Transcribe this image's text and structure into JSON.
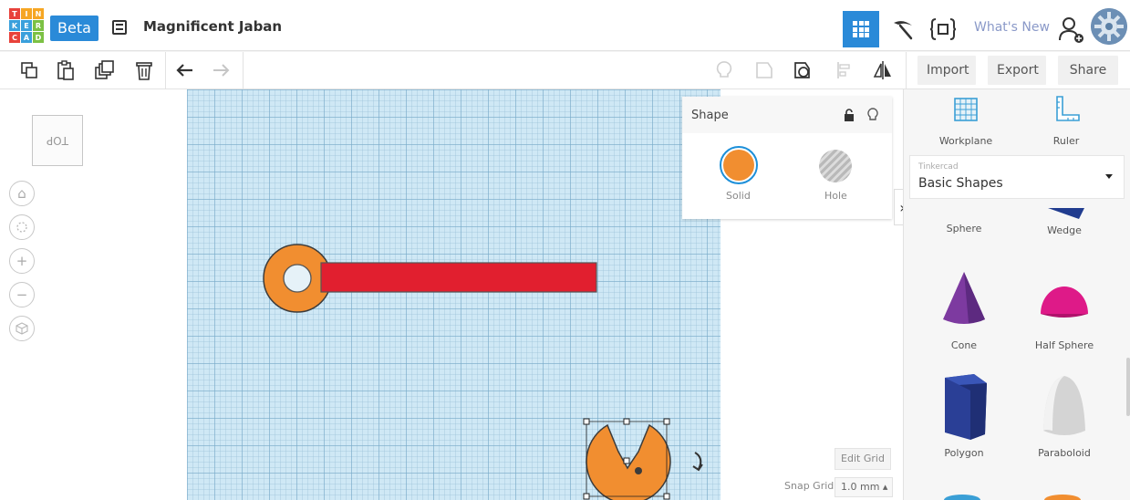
{
  "header": {
    "logo_letters": [
      "T",
      "I",
      "N",
      "K",
      "E",
      "R",
      "C",
      "A",
      "D"
    ],
    "logo_colors": [
      "#e8423b",
      "#f6a623",
      "#f6a623",
      "#3aa0dc",
      "#3aa0dc",
      "#7cc144",
      "#e8423b",
      "#3aa0dc",
      "#7cc144"
    ],
    "beta_label": "Beta",
    "doc_title": "Magnificent Jaban",
    "whats_new": "What's New"
  },
  "toolbar": {
    "import_label": "Import",
    "export_label": "Export",
    "share_label": "Share"
  },
  "viewcube": {
    "face_label": "TOP"
  },
  "shape_panel": {
    "title": "Shape",
    "solid_label": "Solid",
    "hole_label": "Hole",
    "solid_color": "#f18e30"
  },
  "grid_controls": {
    "edit_grid_label": "Edit Grid",
    "snap_grid_label": "Snap Grid",
    "snap_grid_value": "1.0 mm ▴"
  },
  "library": {
    "workplane_label": "Workplane",
    "ruler_label": "Ruler",
    "category_sub": "Tinkercad",
    "category_main": "Basic Shapes",
    "shapes": [
      {
        "name": "Sphere"
      },
      {
        "name": "Wedge"
      },
      {
        "name": "Cone"
      },
      {
        "name": "Half Sphere"
      },
      {
        "name": "Polygon"
      },
      {
        "name": "Paraboloid"
      }
    ]
  },
  "colors": {
    "accent": "#2a8ad8",
    "orange_part": "#f18e30",
    "red_part": "#e11f2f"
  }
}
